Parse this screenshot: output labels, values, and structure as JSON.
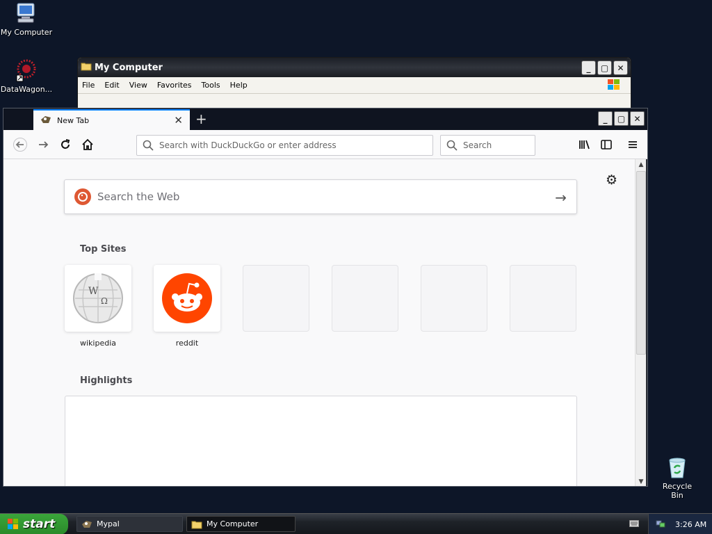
{
  "desktop": {
    "icons": [
      {
        "label": "My Computer"
      },
      {
        "label": "DataWagon..."
      },
      {
        "label": "Recycle Bin"
      }
    ]
  },
  "explorer": {
    "title": "My Computer",
    "menu": [
      "File",
      "Edit",
      "View",
      "Favorites",
      "Tools",
      "Help"
    ]
  },
  "browser": {
    "tab": {
      "label": "New Tab"
    },
    "url_placeholder": "Search with DuckDuckGo or enter address",
    "search_placeholder": "Search",
    "web_search_placeholder": "Search the Web",
    "top_sites_heading": "Top Sites",
    "top_sites": [
      {
        "label": "wikipedia"
      },
      {
        "label": "reddit"
      }
    ],
    "highlights_heading": "Highlights"
  },
  "taskbar": {
    "start_label": "start",
    "tasks": [
      {
        "label": "Mypal"
      },
      {
        "label": "My Computer"
      }
    ],
    "clock": "3:26 AM"
  },
  "colors": {
    "desktop_bg": "#0d1628",
    "accent": "#0a84ff",
    "reddit": "#ff4500",
    "duckduckgo": "#de5833"
  }
}
